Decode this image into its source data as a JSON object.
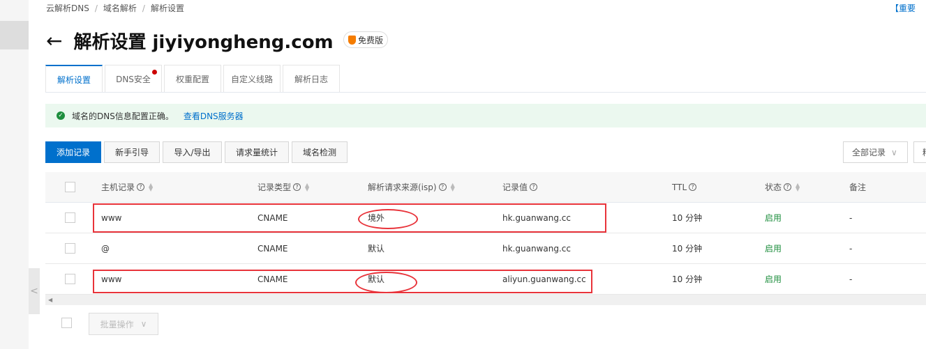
{
  "breadcrumb": [
    "云解析DNS",
    "域名解析",
    "解析设置"
  ],
  "notice": "【重要",
  "title": "解析设置 jiyiyongheng.com",
  "badge": "免费版",
  "tabs": [
    {
      "label": "解析设置",
      "active": true
    },
    {
      "label": "DNS安全",
      "dot": true
    },
    {
      "label": "权重配置"
    },
    {
      "label": "自定义线路"
    },
    {
      "label": "解析日志"
    }
  ],
  "alert": {
    "text": "域名的DNS信息配置正确。",
    "link": "查看DNS服务器"
  },
  "toolbar": {
    "add": "添加记录",
    "guide": "新手引导",
    "io": "导入/导出",
    "stats": "请求量统计",
    "check": "域名检测",
    "filter": "全部记录",
    "filter2": "精"
  },
  "columns": {
    "host": "主机记录",
    "type": "记录类型",
    "isp": "解析请求来源(isp)",
    "value": "记录值",
    "ttl": "TTL",
    "status": "状态",
    "note": "备注"
  },
  "rows": [
    {
      "host": "www",
      "type": "CNAME",
      "isp": "境外",
      "value": "hk.guanwang.cc",
      "ttl": "10 分钟",
      "status": "启用",
      "note": "-"
    },
    {
      "host": "@",
      "type": "CNAME",
      "isp": "默认",
      "value": "hk.guanwang.cc",
      "ttl": "10 分钟",
      "status": "启用",
      "note": "-"
    },
    {
      "host": "www",
      "type": "CNAME",
      "isp": "默认",
      "value": "aliyun.guanwang.cc",
      "ttl": "10 分钟",
      "status": "启用",
      "note": "-"
    }
  ],
  "batch": "批量操作"
}
